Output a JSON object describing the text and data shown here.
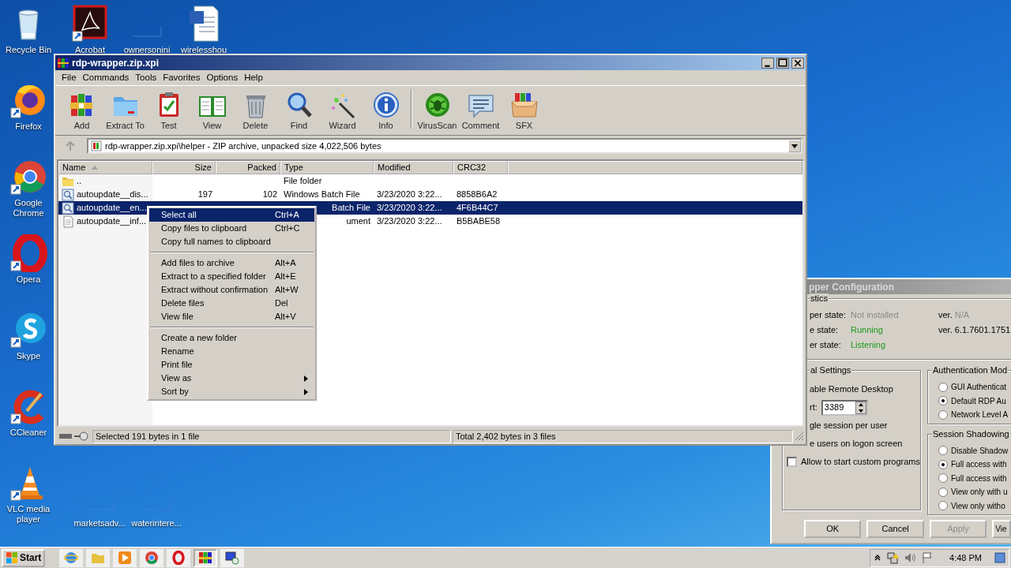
{
  "desktop": {
    "left_column": [
      {
        "label": "Recycle Bin"
      },
      {
        "label": "Firefox"
      },
      {
        "label": "Google Chrome"
      },
      {
        "label": "Opera"
      },
      {
        "label": "Skype"
      },
      {
        "label": "CCleaner"
      },
      {
        "label": "VLC media player"
      }
    ],
    "top_row": [
      {
        "label": "Acrobat"
      },
      {
        "label": "ownersonini"
      },
      {
        "label": "wirelesshou"
      }
    ],
    "bottom_row": [
      {
        "label": "marketsadv..."
      },
      {
        "label": "waterintere..."
      }
    ]
  },
  "archiver": {
    "title": "rdp-wrapper.zip.xpi",
    "menu": [
      "File",
      "Commands",
      "Tools",
      "Favorites",
      "Options",
      "Help"
    ],
    "toolbar": [
      {
        "kind": "button",
        "label": "Add"
      },
      {
        "kind": "button",
        "label": "Extract To"
      },
      {
        "kind": "button",
        "label": "Test"
      },
      {
        "kind": "button",
        "label": "View"
      },
      {
        "kind": "button",
        "label": "Delete"
      },
      {
        "kind": "button",
        "label": "Find"
      },
      {
        "kind": "button",
        "label": "Wizard"
      },
      {
        "kind": "button",
        "label": "Info"
      },
      {
        "kind": "separator"
      },
      {
        "kind": "button",
        "label": "VirusScan"
      },
      {
        "kind": "button",
        "label": "Comment"
      },
      {
        "kind": "button",
        "label": "SFX"
      }
    ],
    "address": "rdp-wrapper.zip.xpi\\helper - ZIP archive, unpacked size 4,022,506 bytes",
    "columns": [
      "Name",
      "Size",
      "Packed",
      "Type",
      "Modified",
      "CRC32"
    ],
    "rows": [
      {
        "kind": "folder",
        "selected": false,
        "under_menu": false,
        "name": "..",
        "type": "File folder"
      },
      {
        "kind": "batch",
        "selected": false,
        "under_menu": false,
        "name": "autoupdate__dis...",
        "size": "197",
        "packed": "102",
        "type": "Windows Batch File",
        "modified": "3/23/2020 3:22...",
        "crc": "8858B6A2"
      },
      {
        "kind": "batch",
        "selected": true,
        "under_menu": true,
        "name": "autoupdate__en...",
        "type": "Batch File",
        "modified": "3/23/2020 3:22...",
        "crc": "4F6B44C7"
      },
      {
        "kind": "text",
        "selected": false,
        "under_menu": true,
        "name": "autoupdate__inf...",
        "type": "ument",
        "modified": "3/23/2020 3:22...",
        "crc": "B5BABE58"
      }
    ],
    "status_left": "Selected 191 bytes in 1 file",
    "status_right": "Total 2,402 bytes in 3 files"
  },
  "context_menu": [
    {
      "kind": "item",
      "label": "Select all",
      "shortcut": "Ctrl+A",
      "selected": true,
      "submenu": false
    },
    {
      "kind": "item",
      "label": "Copy files to clipboard",
      "shortcut": "Ctrl+C",
      "selected": false,
      "submenu": false
    },
    {
      "kind": "item",
      "label": "Copy full names to clipboard",
      "selected": false,
      "submenu": false
    },
    {
      "kind": "separator"
    },
    {
      "kind": "item",
      "label": "Add files to archive",
      "shortcut": "Alt+A",
      "selected": false,
      "submenu": false
    },
    {
      "kind": "item",
      "label": "Extract to a specified folder",
      "shortcut": "Alt+E",
      "selected": false,
      "submenu": false
    },
    {
      "kind": "item",
      "label": "Extract without confirmation",
      "shortcut": "Alt+W",
      "selected": false,
      "submenu": false
    },
    {
      "kind": "item",
      "label": "Delete files",
      "shortcut": "Del",
      "selected": false,
      "submenu": false
    },
    {
      "kind": "item",
      "label": "View file",
      "shortcut": "Alt+V",
      "selected": false,
      "submenu": false
    },
    {
      "kind": "separator"
    },
    {
      "kind": "item",
      "label": "Create a new folder",
      "selected": false,
      "submenu": false
    },
    {
      "kind": "item",
      "label": "Rename",
      "selected": false,
      "submenu": false
    },
    {
      "kind": "item",
      "label": "Print file",
      "selected": false,
      "submenu": false
    },
    {
      "kind": "item",
      "label": "View as",
      "selected": false,
      "submenu": true
    },
    {
      "kind": "item",
      "label": "Sort by",
      "selected": false,
      "submenu": true
    }
  ],
  "config_window": {
    "title": "pper Configuration",
    "diagnostics": {
      "label": "stics",
      "rows": [
        {
          "label": "per state:",
          "value": "Not installed",
          "color": "#8a8a8a",
          "version_label": "ver.",
          "version": "N/A"
        },
        {
          "label": "e state:",
          "value": "Running",
          "color": "#1a9a1a",
          "version_label": "ver. 6.1.7601.1751"
        },
        {
          "label": "er state:",
          "value": "Listening",
          "color": "#1a9a1a"
        }
      ]
    },
    "general": {
      "label": "al Settings",
      "options": [
        {
          "kind": "text",
          "label": "able Remote Desktop"
        },
        {
          "kind": "port",
          "label": "rt:",
          "value": "3389"
        },
        {
          "kind": "text",
          "label": "gle session per user"
        },
        {
          "kind": "text",
          "label": "e users on logon screen"
        },
        {
          "kind": "checkbox",
          "label": "Allow to start custom programs",
          "checked": false
        }
      ]
    },
    "auth": {
      "label": "Authentication Mod",
      "options": [
        {
          "label": "GUI Authenticat",
          "selected": false
        },
        {
          "label": "Default RDP Au",
          "selected": true
        },
        {
          "label": "Network Level A",
          "selected": false
        }
      ]
    },
    "shadow": {
      "label": "Session Shadowing",
      "options": [
        {
          "label": "Disable Shadow",
          "selected": false
        },
        {
          "label": "Full access with",
          "selected": true
        },
        {
          "label": "Full access with",
          "selected": false
        },
        {
          "label": "View only with u",
          "selected": false
        },
        {
          "label": "View only witho",
          "selected": false
        }
      ]
    },
    "buttons": [
      {
        "label": "OK",
        "disabled": false
      },
      {
        "label": "Cancel",
        "disabled": false
      },
      {
        "label": "Apply",
        "disabled": true
      },
      {
        "label": "Vie",
        "disabled": false
      }
    ]
  },
  "taskbar": {
    "start": "Start",
    "apps": [
      {
        "selected": false
      },
      {
        "selected": false
      },
      {
        "selected": false
      },
      {
        "selected": false
      },
      {
        "selected": false
      },
      {
        "selected": true
      },
      {
        "selected": false
      }
    ],
    "clock": "4:48 PM"
  }
}
